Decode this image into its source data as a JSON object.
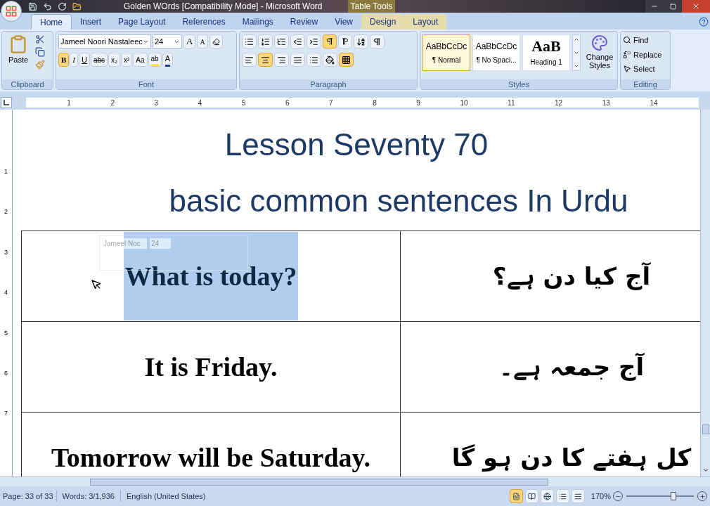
{
  "title_bar": {
    "title": "Golden WOrds [Compatibility Mode] - Microsoft Word",
    "context_tab": "Table Tools"
  },
  "tabs": [
    {
      "label": "Home",
      "selected": true
    },
    {
      "label": "Insert",
      "selected": false
    },
    {
      "label": "Page Layout",
      "selected": false
    },
    {
      "label": "References",
      "selected": false
    },
    {
      "label": "Mailings",
      "selected": false
    },
    {
      "label": "Review",
      "selected": false
    },
    {
      "label": "View",
      "selected": false
    },
    {
      "label": "Design",
      "selected": false
    },
    {
      "label": "Layout",
      "selected": false
    }
  ],
  "clipboard": {
    "paste": "Paste",
    "label": "Clipboard"
  },
  "font": {
    "name": "Jameel Noori Nastaleec",
    "size": "24",
    "label": "Font",
    "grow": "A",
    "shrink": "A",
    "buttons": [
      {
        "kind": "bold",
        "label": "B",
        "on": true
      },
      {
        "kind": "italic",
        "label": "I",
        "on": false
      },
      {
        "kind": "underline",
        "label": "U",
        "on": false
      },
      {
        "kind": "strike",
        "label": "abc",
        "on": false
      },
      {
        "kind": "sub",
        "label": "x₂",
        "on": false
      },
      {
        "kind": "sup",
        "label": "x²",
        "on": false
      },
      {
        "kind": "case",
        "label": "Aa",
        "on": false
      },
      {
        "kind": "highlight",
        "label": "ab",
        "on": false
      },
      {
        "kind": "color",
        "label": "A",
        "on": false
      }
    ]
  },
  "paragraph": {
    "label": "Paragraph",
    "ltr": true,
    "rtl": false,
    "show_marks": false,
    "alignments": [
      {
        "kind": "left",
        "selected": false
      },
      {
        "kind": "center",
        "selected": true
      },
      {
        "kind": "right",
        "selected": false
      },
      {
        "kind": "justify",
        "selected": false
      }
    ]
  },
  "styles": {
    "label": "Styles",
    "items": [
      {
        "sample": "AaBbCcDc",
        "name": "¶ Normal",
        "selected": true,
        "kind": "normal"
      },
      {
        "sample": "AaBbCcDc",
        "name": "¶ No Spaci...",
        "selected": false,
        "kind": "normal"
      },
      {
        "sample": "AaB",
        "name": "Heading 1",
        "selected": false,
        "kind": "heading"
      }
    ],
    "change": "Change Styles"
  },
  "editing": {
    "label": "Editing",
    "find": "Find",
    "replace": "Replace",
    "select": "Select"
  },
  "ruler": [
    "1",
    "2",
    "3",
    "4",
    "5",
    "6",
    "7",
    "8",
    "9",
    "10",
    "11",
    "12",
    "13",
    "14"
  ],
  "vruler": [
    "1",
    "2",
    "3",
    "4",
    "5",
    "6",
    "7"
  ],
  "document": {
    "headings": [
      "Lesson Seventy 70",
      "basic common sentences In Urdu"
    ],
    "rows": [
      {
        "english": "What is today?",
        "urdu": "آج کیا دن ہے؟",
        "selected": true
      },
      {
        "english": "It is Friday.",
        "urdu": "آج جمعہ ہے۔",
        "selected": false
      },
      {
        "english": "Tomorrow will be Saturday.",
        "urdu": "کل ہفتے کا دن ہو گا",
        "selected": false
      }
    ],
    "mini_toolbar": {
      "font": "Jameel Noc",
      "size": "24"
    }
  },
  "status_bar": {
    "page": "Page: 33 of 33",
    "words": "Words: 3/1,936",
    "language": "English (United States)",
    "zoom": "170%",
    "level": 0.72
  }
}
